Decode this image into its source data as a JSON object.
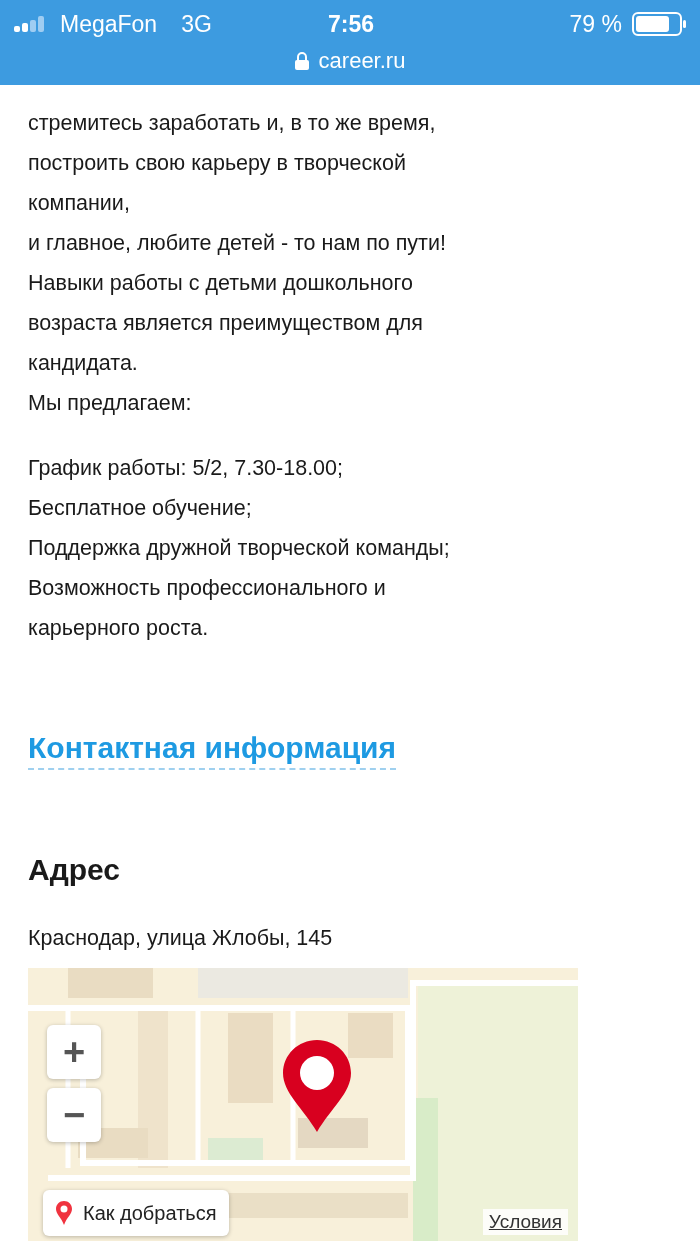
{
  "status_bar": {
    "carrier": "MegaFon",
    "network": "3G",
    "time": "7:56",
    "battery": "79 %"
  },
  "address_bar": {
    "url": "career.ru"
  },
  "description_lines": [
    "стремитесь заработать и, в то же время,",
    "построить свою карьеру в творческой",
    "компании,",
    "и главное, любите детей - то нам по пути!",
    "Навыки работы с детьми дошкольного",
    "возраста является преимуществом для",
    "кандидата.",
    "Мы предлагаем:"
  ],
  "offer_lines": [
    "График работы: 5/2, 7.30-18.00;",
    "Бесплатное обучение;",
    "Поддержка дружной творческой команды;",
    "Возможность профессионального и",
    "карьерного роста."
  ],
  "contact_heading": "Контактная информация",
  "address_heading": "Адрес",
  "address": "Краснодар, улица Жлобы, 145",
  "map": {
    "kind": "picture",
    "zoom_in": "+",
    "zoom_out": "−",
    "route_button": "Как добраться",
    "terms_link": "Условия"
  }
}
